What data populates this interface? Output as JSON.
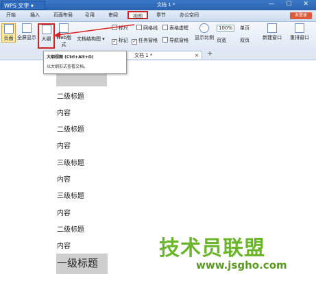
{
  "titlebar": {
    "app_name": "WPS 文字",
    "doc_title": "文档 1 *",
    "controls": "— ☐ ✕"
  },
  "menu": {
    "items": [
      "开始",
      "插入",
      "页面布局",
      "引用",
      "审阅",
      "视图",
      "章节",
      "办公空间"
    ],
    "active": "视图",
    "login": "未登录"
  },
  "ribbon": {
    "buttons": [
      {
        "label": "页面",
        "icon": "page-view-icon"
      },
      {
        "label": "全屏显示",
        "icon": "fullscreen-icon"
      },
      {
        "label": "大纲",
        "icon": "outline-icon"
      },
      {
        "label": "Web版式",
        "icon": "web-layout-icon"
      }
    ],
    "doc_structure": "文档结构图",
    "checkboxes": {
      "ruler": "标尺",
      "grid": "网格线",
      "table_gridlines": "表格虚框",
      "mark": "标记",
      "task_pane": "任务窗格",
      "nav_pane": "导航窗格"
    },
    "zoom_label": "显示比例",
    "zoom_value": "100%",
    "single_page": "单页",
    "page_width": "页宽",
    "two_pages": "双页",
    "new_window": "新建窗口",
    "arrange_window": "重排窗口"
  },
  "tabs": {
    "doc_tab": "文档 1 *",
    "close": "×",
    "add": "+"
  },
  "tooltip": {
    "title": "大纲视图 (Ctrl+Alt+O)",
    "description": "以大纲形式查看文档。"
  },
  "document": {
    "lines": [
      "二级标题",
      "内容",
      "二级标题",
      "内容",
      "三级标题",
      "内容",
      "三级标题",
      "内容",
      "二级标题",
      "内容"
    ],
    "h1": "一级标题"
  },
  "watermark": {
    "text": "技术员联盟",
    "url": "www.jsgho.com"
  }
}
